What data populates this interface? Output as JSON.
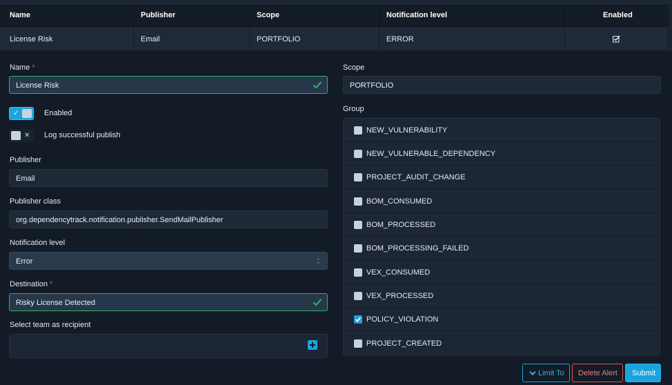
{
  "table": {
    "headers": [
      "Name",
      "Publisher",
      "Scope",
      "Notification level",
      "Enabled"
    ],
    "row": {
      "name": "License Risk",
      "publisher": "Email",
      "scope": "PORTFOLIO",
      "level": "ERROR",
      "enabled_icon": "checkbox-checked-icon"
    }
  },
  "form": {
    "name_label": "Name",
    "name_value": "License Risk",
    "enabled_label": "Enabled",
    "log_label": "Log successful publish",
    "publisher_label": "Publisher",
    "publisher_value": "Email",
    "publisher_class_label": "Publisher class",
    "publisher_class_value": "org.dependencytrack.notification.publisher.SendMailPublisher",
    "level_label": "Notification level",
    "level_value": "Error",
    "destination_label": "Destination",
    "destination_value": "Risky License Detected",
    "team_label": "Select team as recipient",
    "scope_label": "Scope",
    "scope_value": "PORTFOLIO",
    "group_label": "Group",
    "required_mark": "*"
  },
  "groups": [
    {
      "label": "NEW_VULNERABILITY",
      "checked": false
    },
    {
      "label": "NEW_VULNERABLE_DEPENDENCY",
      "checked": false
    },
    {
      "label": "PROJECT_AUDIT_CHANGE",
      "checked": false
    },
    {
      "label": "BOM_CONSUMED",
      "checked": false
    },
    {
      "label": "BOM_PROCESSED",
      "checked": false
    },
    {
      "label": "BOM_PROCESSING_FAILED",
      "checked": false
    },
    {
      "label": "VEX_CONSUMED",
      "checked": false
    },
    {
      "label": "VEX_PROCESSED",
      "checked": false
    },
    {
      "label": "POLICY_VIOLATION",
      "checked": true
    },
    {
      "label": "PROJECT_CREATED",
      "checked": false
    }
  ],
  "buttons": {
    "limit_to": "Limit To",
    "delete_alert": "Delete Alert",
    "submit": "Submit"
  },
  "colors": {
    "accent": "#1aa4dd",
    "valid": "#2fb36c",
    "danger": "#e55353"
  }
}
